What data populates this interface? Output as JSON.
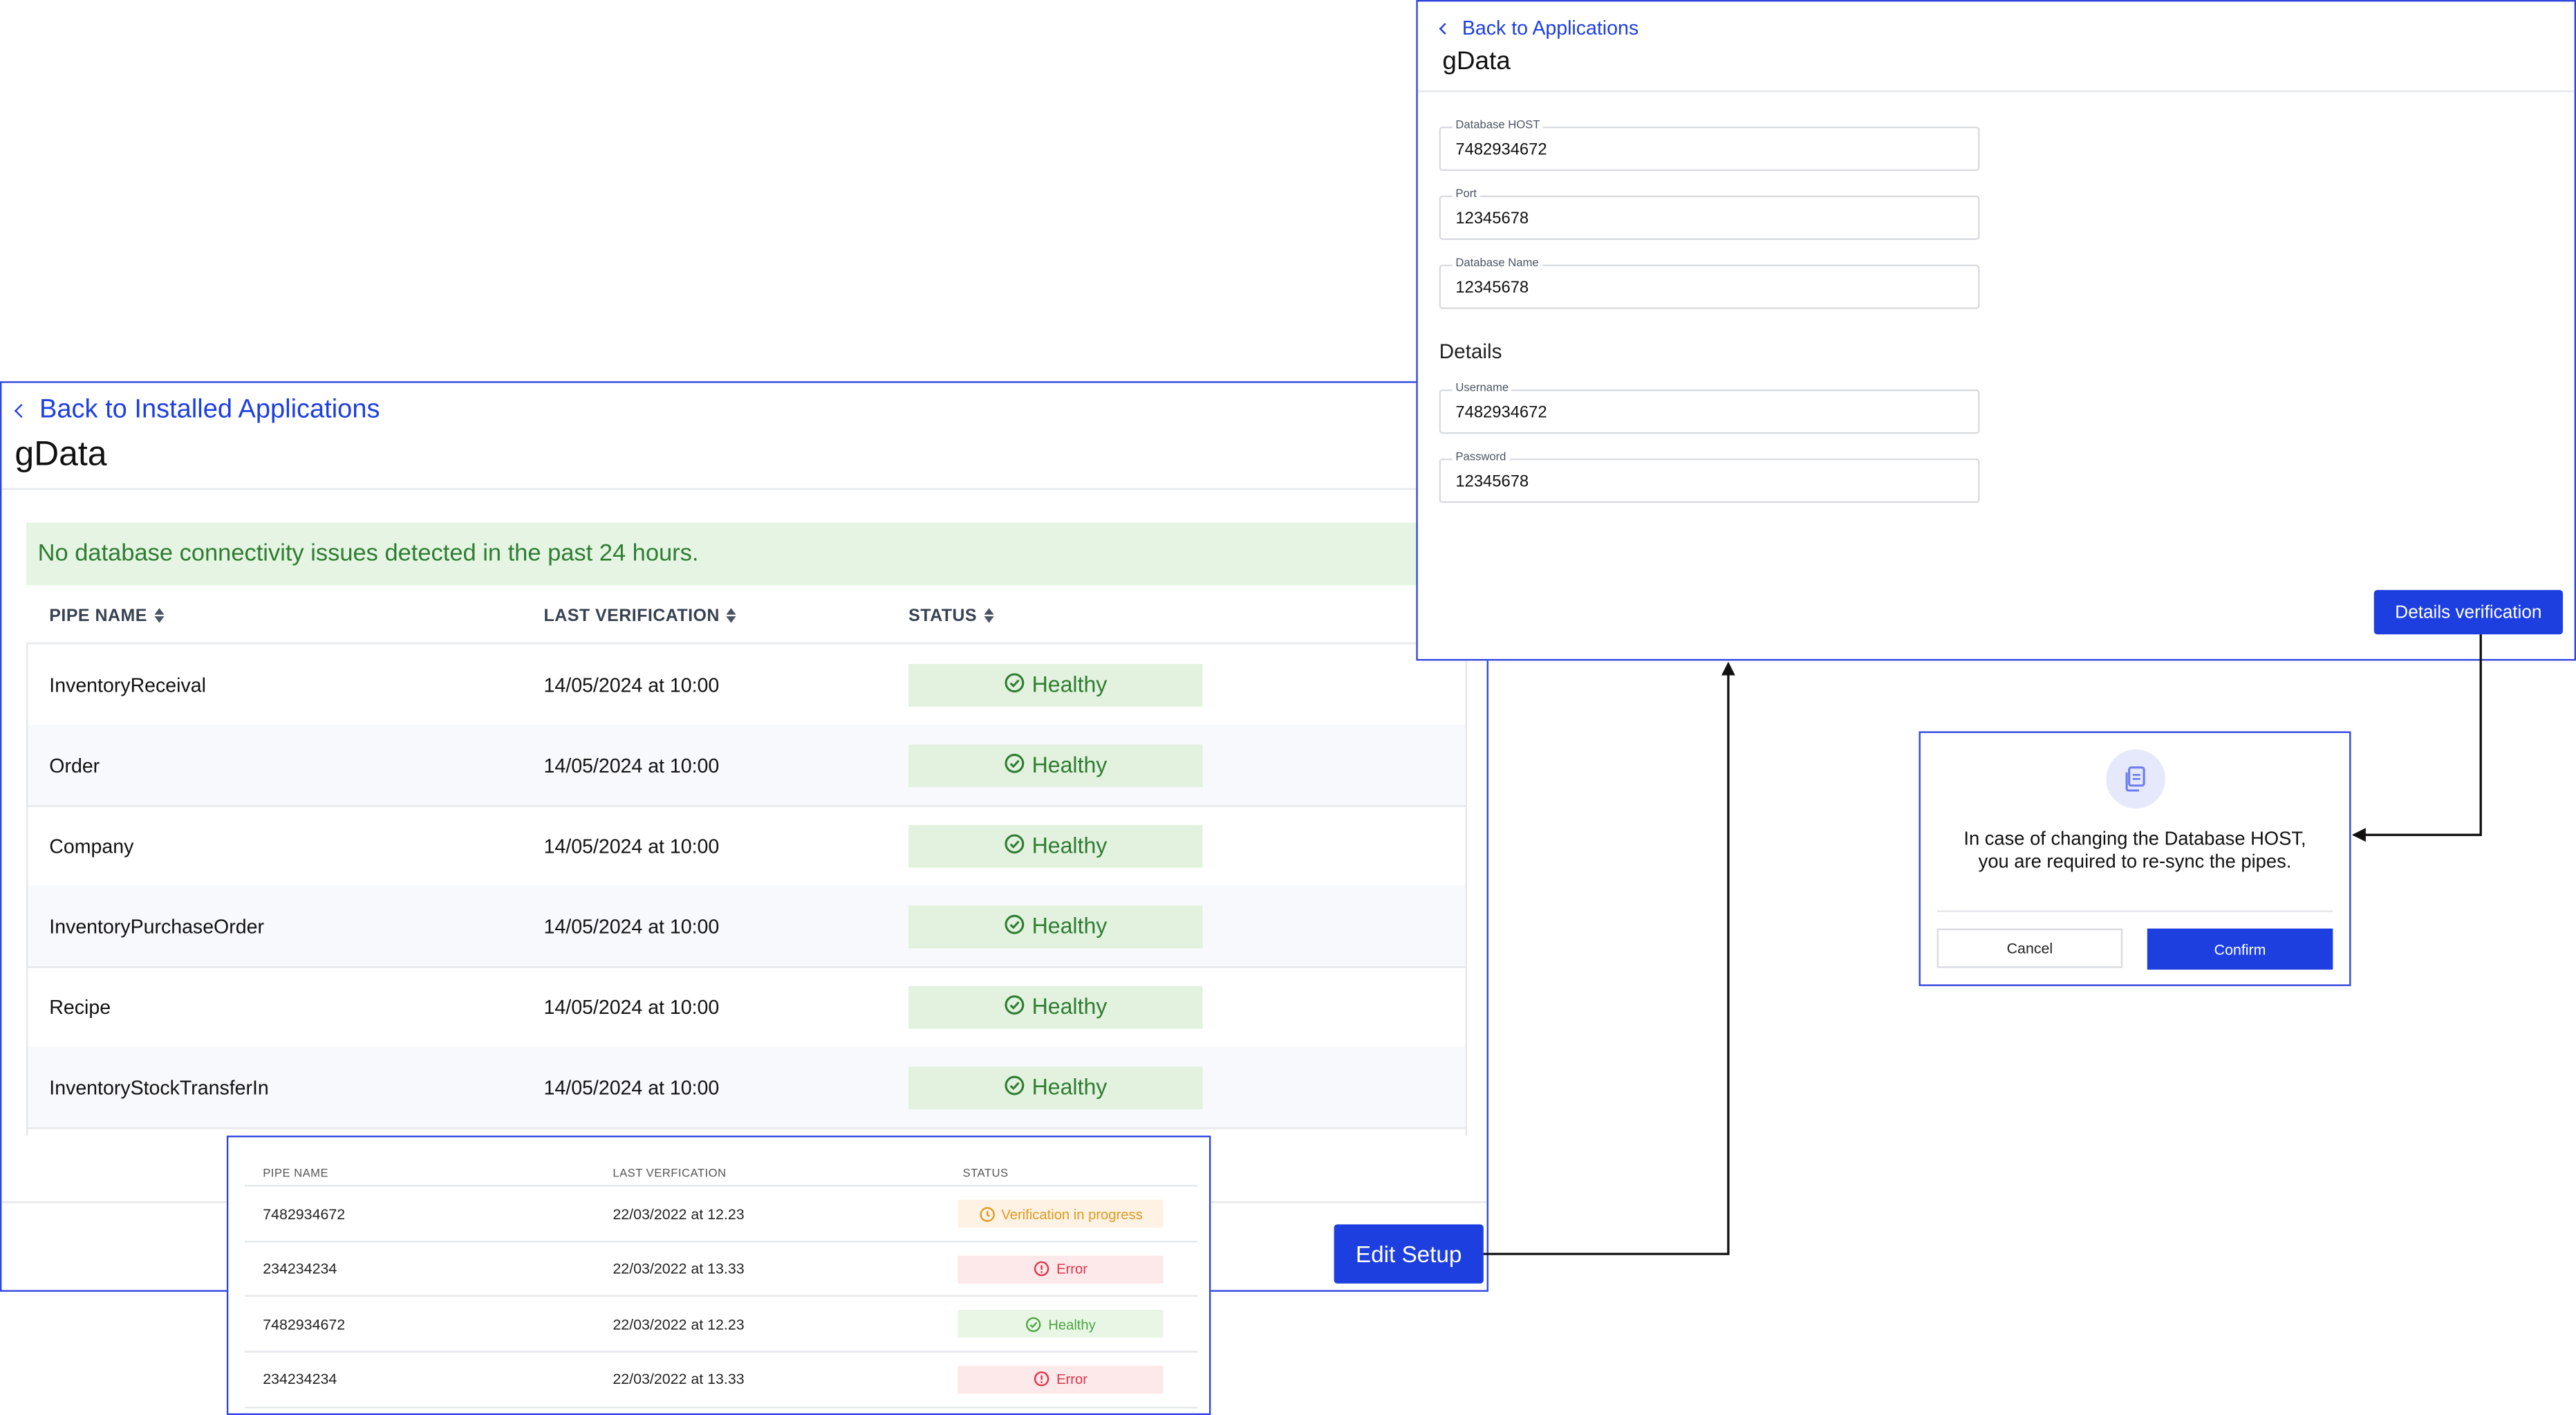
{
  "main": {
    "back_label": "Back to Installed Applications",
    "title": "gData",
    "banner": "No database connectivity issues detected in the past 24 hours.",
    "columns": [
      "PIPE NAME",
      "LAST VERIFICATION",
      "STATUS"
    ],
    "rows": [
      {
        "name": "InventoryReceival",
        "last": "14/05/2024 at 10:00",
        "status": "Healthy"
      },
      {
        "name": "Order",
        "last": "14/05/2024 at 10:00",
        "status": "Healthy"
      },
      {
        "name": "Company",
        "last": "14/05/2024 at 10:00",
        "status": "Healthy"
      },
      {
        "name": "InventoryPurchaseOrder",
        "last": "14/05/2024 at 10:00",
        "status": "Healthy"
      },
      {
        "name": "Recipe",
        "last": "14/05/2024 at 10:00",
        "status": "Healthy"
      },
      {
        "name": "InventoryStockTransferIn",
        "last": "14/05/2024 at 10:00",
        "status": "Healthy"
      }
    ],
    "edit_button": "Edit Setup"
  },
  "pipes_small": {
    "columns": [
      "PIPE NAME",
      "LAST VERFICATION",
      "STATUS"
    ],
    "rows": [
      {
        "name": "7482934672",
        "last": "22/03/2022 at 12.23",
        "status": "Verification in progress",
        "kind": "progress"
      },
      {
        "name": "234234234",
        "last": "22/03/2022 at 13.33",
        "status": "Error",
        "kind": "error"
      },
      {
        "name": "7482934672",
        "last": "22/03/2022 at 12.23",
        "status": "Healthy",
        "kind": "healthy"
      },
      {
        "name": "234234234",
        "last": "22/03/2022 at 13.33",
        "status": "Error",
        "kind": "error"
      }
    ]
  },
  "edit": {
    "back_label": "Back to Applications",
    "title": "gData",
    "fields": [
      {
        "label": "Database HOST",
        "value": "7482934672"
      },
      {
        "label": "Port",
        "value": "12345678"
      },
      {
        "label": "Database Name",
        "value": "12345678"
      }
    ],
    "details_heading": "Details",
    "detail_fields": [
      {
        "label": "Username",
        "value": "7482934672"
      },
      {
        "label": "Password",
        "value": "12345678"
      }
    ],
    "verify_button": "Details verification"
  },
  "dialog": {
    "message_line1": "In case of changing the Database HOST,",
    "message_line2": "you are required to re-sync the pipes.",
    "cancel": "Cancel",
    "confirm": "Confirm"
  },
  "colors": {
    "accent": "#1d3fe0",
    "frame": "#2f45e0",
    "healthy_bg": "#e3f2df",
    "healthy_text": "#2e7d32",
    "error_bg": "#fde8ea",
    "error_text": "#d9364a",
    "progress_bg": "#fdf2e4",
    "progress_text": "#e09a20"
  },
  "icons": {
    "back": "chevron-left-icon",
    "sort": "sort-icon",
    "healthy": "check-circle-icon",
    "error": "alert-circle-icon",
    "progress": "clock-icon",
    "dialog": "documents-icon"
  }
}
